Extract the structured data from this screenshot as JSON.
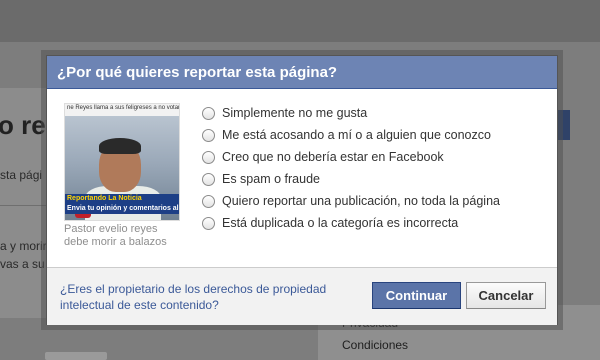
{
  "background": {
    "heading": "o reye",
    "subtext": "sta pági",
    "body_line1": "a y morir",
    "body_line2": "vas a su",
    "menu_item1": "Privacidad",
    "menu_item2": "Condiciones"
  },
  "dialog": {
    "title": "¿Por qué quieres reportar esta página?",
    "thumbnail": {
      "top_line": "ne Reyes llama a sus feligreses a no votar por Co",
      "banner_line1": "Reportando La Noticia",
      "banner_line2": "Envia tu opinión y comentarios al",
      "caption": "Pastor evelio reyes debe morir a balazos"
    },
    "options": [
      "Simplemente no me gusta",
      "Me está acosando a mí o a alguien que conozco",
      "Creo que no debería estar en Facebook",
      "Es spam o fraude",
      "Quiero reportar una publicación, no toda la página",
      "Está duplicada o la categoría es incorrecta"
    ],
    "footer": {
      "owner_link": "¿Eres el propietario de los derechos de propiedad intelectual de este contenido?",
      "continue_label": "Continuar",
      "cancel_label": "Cancelar"
    }
  },
  "colors": {
    "header_bg": "#6d84b4",
    "link": "#3b5998",
    "primary_button": "#5b74a8"
  }
}
